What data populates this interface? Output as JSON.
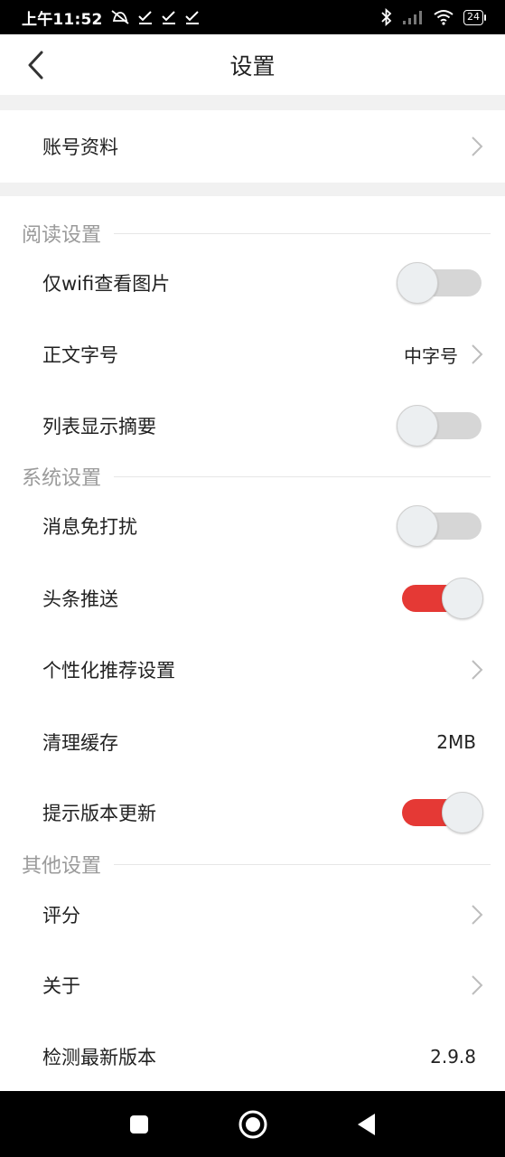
{
  "status_bar": {
    "time": "上午11:52",
    "battery": "24",
    "left_icons": [
      "mute-icon",
      "check-icon",
      "check-icon",
      "check-icon"
    ],
    "right_icons": [
      "bluetooth-icon",
      "signal-icon",
      "wifi-icon",
      "battery-icon"
    ]
  },
  "header": {
    "title": "设置",
    "back_icon": "back-arrow-icon"
  },
  "account": {
    "label": "账号资料"
  },
  "reading": {
    "title": "阅读设置",
    "wifi_images": {
      "label": "仅wifi查看图片",
      "on": false
    },
    "font_size": {
      "label": "正文字号",
      "value": "中字号"
    },
    "show_summary": {
      "label": "列表显示摘要",
      "on": false
    }
  },
  "system": {
    "title": "系统设置",
    "dnd": {
      "label": "消息免打扰",
      "on": false
    },
    "headline_push": {
      "label": "头条推送",
      "on": true
    },
    "personalized": {
      "label": "个性化推荐设置"
    },
    "clear_cache": {
      "label": "清理缓存",
      "value": "2MB"
    },
    "update_prompt": {
      "label": "提示版本更新",
      "on": true
    }
  },
  "other": {
    "title": "其他设置",
    "rate": {
      "label": "评分"
    },
    "about": {
      "label": "关于"
    },
    "check_version": {
      "label": "检测最新版本",
      "value": "2.9.8"
    }
  },
  "colors": {
    "accent": "#e53935",
    "toggle_off": "#d6d6d6",
    "section_title": "#9a9a9a",
    "band": "#f1f1f1"
  },
  "nav_bar": [
    "recent-apps-icon",
    "home-icon",
    "back-icon"
  ]
}
